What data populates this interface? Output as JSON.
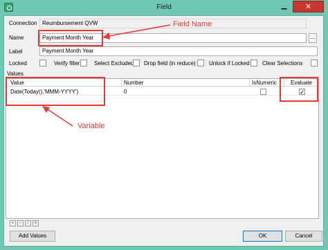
{
  "window": {
    "title": "Field"
  },
  "form": {
    "connection_label": "Connection",
    "connection_value": "Reumbursement QVW",
    "name_label": "Name",
    "name_value": "Payment Month Year",
    "name_browse": "...",
    "label_label": "Label",
    "label_value": "Payment Month Year",
    "options": [
      {
        "label": "Locked"
      },
      {
        "label": "Verify filter"
      },
      {
        "label": "Select Excluded"
      },
      {
        "label": "Drop field (in reduce)"
      },
      {
        "label": "Unlock if Locked"
      },
      {
        "label": "Clear Selections"
      }
    ]
  },
  "values": {
    "section_label": "Values",
    "columns": [
      "Value",
      "Number",
      "IsNumeric",
      "Evaluate"
    ],
    "rows": [
      {
        "value": "Date(Today(),'MMM-YYYY')",
        "number": "0",
        "is_numeric": false,
        "evaluate": true
      }
    ],
    "toolbar": {
      "add": "+",
      "remove": "−",
      "confirm": "✓",
      "cancel": "✕"
    }
  },
  "buttons": {
    "add_values": "Add Values",
    "ok": "OK",
    "cancel": "Cancel"
  },
  "annotations": {
    "field_name": "Field Name",
    "variable": "Variable"
  },
  "colors": {
    "annotation_red": "#e53935",
    "titlebar": "#6ec8b4",
    "close": "#c7372f"
  }
}
